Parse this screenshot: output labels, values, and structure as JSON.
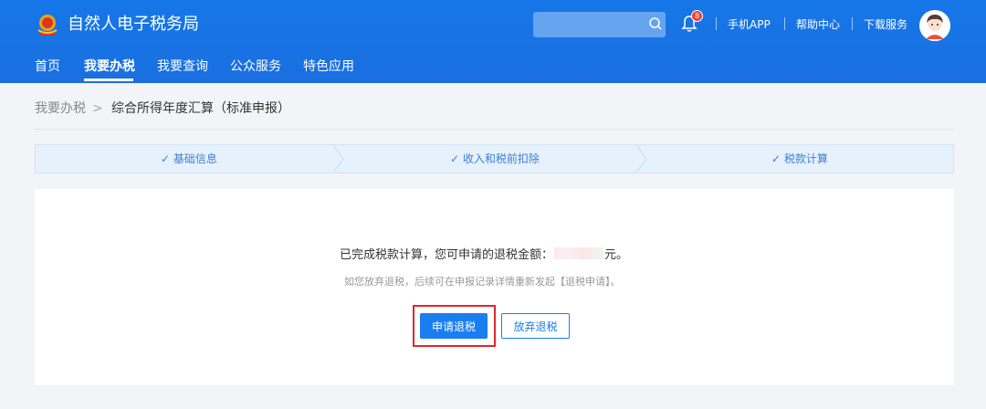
{
  "header": {
    "app_title": "自然人电子税务局",
    "search": {
      "placeholder": "",
      "icon": "search-icon"
    },
    "notifications": {
      "icon": "bell-icon",
      "count": "8"
    },
    "links": [
      "手机APP",
      "帮助中心",
      "下载服务"
    ],
    "avatar": {
      "icon": "avatar-icon"
    }
  },
  "nav": {
    "items": [
      "首页",
      "我要办税",
      "我要查询",
      "公众服务",
      "特色应用"
    ],
    "active": "我要办税"
  },
  "breadcrumb": {
    "parent": "我要办税",
    "separator": ">",
    "current": "综合所得年度汇算（标准申报）"
  },
  "steps": [
    {
      "label": "✓ 基础信息",
      "icon": "check-icon"
    },
    {
      "label": "✓ 收入和税前扣除",
      "icon": "check-icon"
    },
    {
      "label": "✓ 税款计算",
      "icon": "check-icon"
    }
  ],
  "result": {
    "message_prefix": "已完成税款计算，您可申请的退税金额：",
    "message_suffix": "元。",
    "note": "如您放弃退税，后续可在申报记录详情重新发起【退税申请】。"
  },
  "actions": {
    "apply_refund": "申请退税",
    "abandon_refund": "放弃退税"
  },
  "colors": {
    "header_blue": "#1677e8",
    "primary": "#1a7ef0",
    "highlight_red": "#e3242b",
    "step_bg": "#e6f1fc"
  }
}
